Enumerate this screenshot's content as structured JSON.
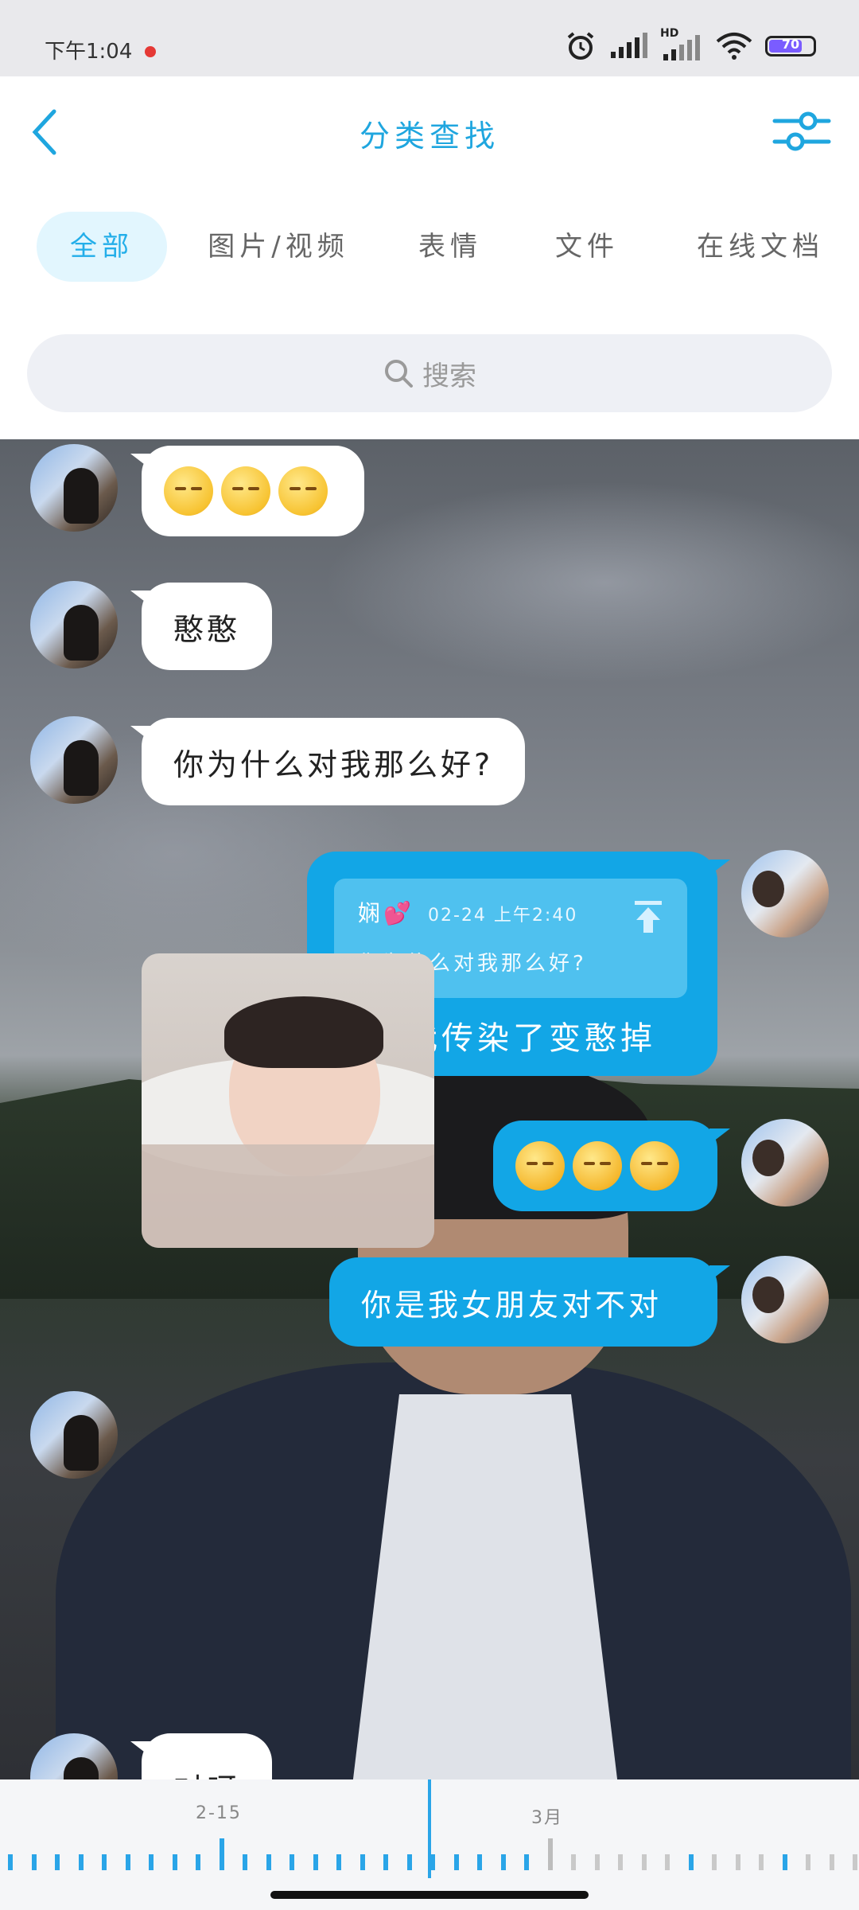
{
  "status_bar": {
    "time": "下午1:04",
    "battery_level": "70",
    "network_label": "HD",
    "icons": [
      "alarm-icon",
      "signal-icon",
      "signal-hd-icon",
      "wifi-icon",
      "battery-icon"
    ]
  },
  "header": {
    "title": "分类查找",
    "back_icon": "chevron-left-icon",
    "filter_icon": "sliders-icon"
  },
  "tabs": [
    {
      "label": "全部",
      "active": true
    },
    {
      "label": "图片/视频",
      "active": false
    },
    {
      "label": "表情",
      "active": false
    },
    {
      "label": "文件",
      "active": false
    },
    {
      "label": "在线文档",
      "active": false
    }
  ],
  "search": {
    "placeholder": "搜索",
    "icon": "search-icon"
  },
  "messages": [
    {
      "side": "left",
      "type": "emoji",
      "emoji": [
        "pensive-face",
        "pensive-face",
        "pensive-face"
      ]
    },
    {
      "side": "left",
      "type": "text",
      "text": "憨憨"
    },
    {
      "side": "left",
      "type": "text",
      "text": "你为什么对我那么好?"
    },
    {
      "side": "right",
      "type": "reply",
      "quote": {
        "sender": "娴💕",
        "time": "02-24 上午2:40",
        "text": "你为什么对我那么好?"
      },
      "text": "你被我传染了变憨掉"
    },
    {
      "side": "right",
      "type": "emoji",
      "emoji": [
        "laughing-face",
        "laughing-face",
        "laughing-face"
      ]
    },
    {
      "side": "right",
      "type": "text",
      "text": "你是我女朋友对不对"
    },
    {
      "side": "left",
      "type": "image",
      "description": "baby-in-bath-photo"
    },
    {
      "side": "left",
      "type": "text",
      "text": "对呀"
    }
  ],
  "timeline": {
    "labels": [
      "2-15",
      "3月"
    ],
    "accent_color": "#2aa5e8"
  },
  "colors": {
    "accent": "#1fa6df",
    "my_bubble": "#12a6e6",
    "active_tab_bg": "#e2f6fe"
  }
}
